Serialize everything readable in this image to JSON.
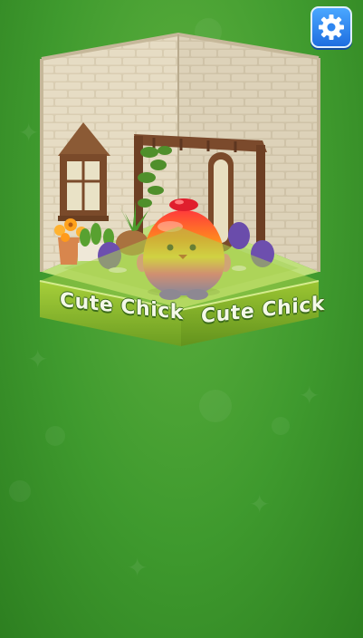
{
  "room": {
    "label_left": "Cute Chick",
    "label_right": "Cute Chick"
  },
  "icons": {
    "settings": "gear-icon"
  },
  "colors": {
    "background": "#3f9a2e",
    "settings_button": "#2f86f0"
  }
}
